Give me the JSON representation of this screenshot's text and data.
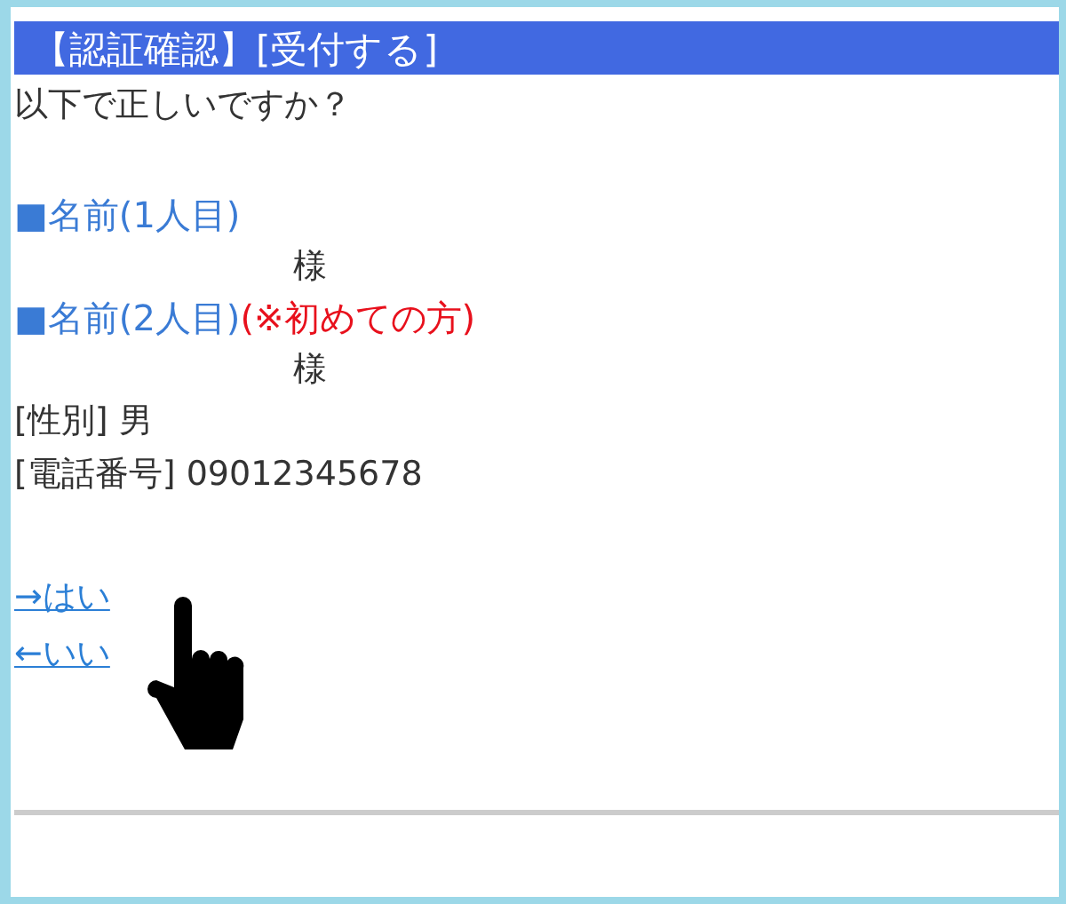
{
  "header": {
    "title": "【認証確認】[受付する]"
  },
  "prompt": "以下で正しいですか？",
  "names": [
    {
      "marker": "■",
      "label": "名前(1人目)",
      "suffix": "様"
    },
    {
      "marker": "■",
      "label": "名前(2人目)",
      "note": "(※初めての方)",
      "suffix": "様"
    }
  ],
  "fields": [
    {
      "label": "[性別]",
      "value": "男"
    },
    {
      "label": "[電話番号]",
      "value": "09012345678"
    }
  ],
  "links": [
    {
      "text": "→はい"
    },
    {
      "text": "←いい"
    }
  ]
}
